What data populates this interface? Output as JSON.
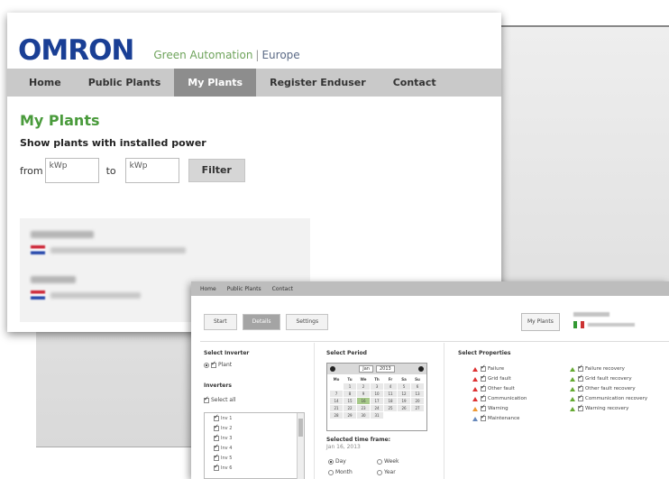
{
  "omron": {
    "logo": "OMRON",
    "tagline_a": "Green Automation",
    "tagline_sep": "|",
    "tagline_b": "Europe",
    "nav": [
      "Home",
      "Public Plants",
      "My Plants",
      "Register Enduser",
      "Contact"
    ],
    "active_nav": "My Plants",
    "page_title": "My Plants",
    "subtitle": "Show plants with installed power",
    "filter": {
      "from_label": "from",
      "from_value": "kWp",
      "to_label": "to",
      "to_value": "kWp",
      "button": "Filter"
    }
  },
  "app": {
    "topbar": [
      "Home",
      "Public Plants",
      "Contact"
    ],
    "tabs": [
      "Start",
      "Details",
      "Settings"
    ],
    "active_tab": "Details",
    "my_button": "My Plants",
    "select_inverter": {
      "title": "Select Inverter",
      "plant_option": "Plant",
      "inverters_title": "Inverters",
      "select_all": "Select all",
      "items": [
        "Inv 1",
        "Inv 2",
        "Inv 3",
        "Inv 4",
        "Inv 5",
        "Inv 6"
      ]
    },
    "select_period": {
      "title": "Select Period",
      "month": "Jan",
      "year": "2013",
      "weekdays": [
        "Mo",
        "Tu",
        "We",
        "Th",
        "Fr",
        "Sa",
        "Su"
      ],
      "days": [
        "",
        "1",
        "2",
        "3",
        "4",
        "5",
        "6",
        "7",
        "8",
        "9",
        "10",
        "11",
        "12",
        "13",
        "14",
        "15",
        "16",
        "17",
        "18",
        "19",
        "20",
        "21",
        "22",
        "23",
        "24",
        "25",
        "26",
        "27",
        "28",
        "29",
        "30",
        "31"
      ],
      "selected_day": "16",
      "timeframe_title": "Selected time frame:",
      "timeframe_value": "Jan 16, 2013",
      "ranges": [
        "Day",
        "Week",
        "Month",
        "Year"
      ],
      "selected_range": "Day"
    },
    "select_properties": {
      "title": "Select Properties",
      "left": [
        {
          "label": "Failure",
          "color": "red"
        },
        {
          "label": "Grid fault",
          "color": "red"
        },
        {
          "label": "Other fault",
          "color": "red"
        },
        {
          "label": "Communication",
          "color": "red"
        },
        {
          "label": "Warning",
          "color": "amber"
        },
        {
          "label": "Maintenance",
          "color": "blue"
        }
      ],
      "right": [
        {
          "label": "Failure recovery",
          "color": "green"
        },
        {
          "label": "Grid fault recovery",
          "color": "green"
        },
        {
          "label": "Other fault recovery",
          "color": "green"
        },
        {
          "label": "Communication recovery",
          "color": "green"
        },
        {
          "label": "Warning recovery",
          "color": "green"
        }
      ]
    }
  }
}
